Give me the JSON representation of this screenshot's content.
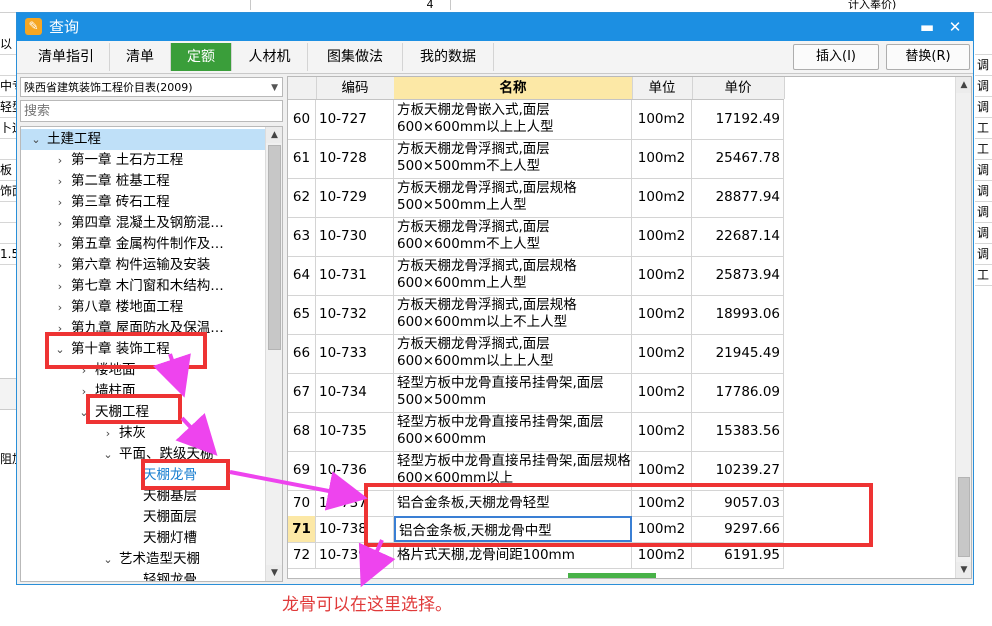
{
  "background": {
    "top_cells": [
      "",
      "4"
    ],
    "top_right_text": "计入奉价)",
    "left_fragments": [
      "以",
      "",
      "中专",
      "轻型",
      "卜运",
      "",
      "板",
      "饰面",
      "",
      "",
      "1.5"
    ],
    "right_fragments": [
      "",
      "调",
      "调",
      "调",
      "工",
      "工",
      "调",
      "调",
      "调",
      "调",
      "调",
      "工"
    ],
    "left_lower_fragment": "阻加"
  },
  "dialog": {
    "title": "查询",
    "title_icon": "query-icon",
    "minimize_symbol": "▬",
    "close_symbol": "✕",
    "tabs": [
      {
        "label": "清单指引",
        "active": false
      },
      {
        "label": "清单",
        "active": false
      },
      {
        "label": "定额",
        "active": true
      },
      {
        "label": "人材机",
        "active": false
      },
      {
        "label": "图集做法",
        "active": false
      },
      {
        "label": "我的数据",
        "active": false
      }
    ],
    "insert_button": "插入(I)",
    "replace_button": "替换(R)",
    "accent_color": "#3a9e3a",
    "title_color": "#1c8fe2"
  },
  "left_panel": {
    "library": "陕西省建筑装饰工程价目表(2009)",
    "search_placeholder": "搜索",
    "tree": [
      {
        "label": "土建工程",
        "level": 0,
        "expanded": true,
        "selected": true
      },
      {
        "label": "第一章  土石方工程",
        "level": 1,
        "expanded": false
      },
      {
        "label": "第二章  桩基工程",
        "level": 1,
        "expanded": false
      },
      {
        "label": "第三章  砖石工程",
        "level": 1,
        "expanded": false
      },
      {
        "label": "第四章  混凝土及钢筋混…",
        "level": 1,
        "expanded": false
      },
      {
        "label": "第五章  金属构件制作及…",
        "level": 1,
        "expanded": false
      },
      {
        "label": "第六章  构件运输及安装",
        "level": 1,
        "expanded": false
      },
      {
        "label": "第七章  木门窗和木结构…",
        "level": 1,
        "expanded": false
      },
      {
        "label": "第八章  楼地面工程",
        "level": 1,
        "expanded": false
      },
      {
        "label": "第九章  屋面防水及保温…",
        "level": 1,
        "expanded": false
      },
      {
        "label": "第十章  装饰工程",
        "level": 1,
        "expanded": true
      },
      {
        "label": "楼地面",
        "level": 2,
        "expanded": false
      },
      {
        "label": "墙柱面",
        "level": 2,
        "expanded": false
      },
      {
        "label": "天棚工程",
        "level": 2,
        "expanded": true
      },
      {
        "label": "抹灰",
        "level": 3,
        "expanded": false
      },
      {
        "label": "平面、跌级天棚",
        "level": 3,
        "expanded": true
      },
      {
        "label": "天棚龙骨",
        "level": 4,
        "leaf": true,
        "link": true
      },
      {
        "label": "天棚基层",
        "level": 4,
        "leaf": true
      },
      {
        "label": "天棚面层",
        "level": 4,
        "leaf": true
      },
      {
        "label": "天棚灯槽",
        "level": 4,
        "leaf": true
      },
      {
        "label": "艺术造型天棚",
        "level": 3,
        "expanded": true
      },
      {
        "label": "轻钢龙骨",
        "level": 4,
        "leaf": true
      }
    ]
  },
  "grid": {
    "headers": [
      "",
      "编码",
      "名称",
      "单位",
      "单价"
    ],
    "rows": [
      {
        "no": "60",
        "code": "10-727",
        "name": "方板天棚龙骨嵌入式,面层600×600mm以上上人型",
        "unit": "100m2",
        "price": "17192.49"
      },
      {
        "no": "61",
        "code": "10-728",
        "name": "方板天棚龙骨浮搁式,面层500×500mm不上人型",
        "unit": "100m2",
        "price": "25467.78"
      },
      {
        "no": "62",
        "code": "10-729",
        "name": "方板天棚龙骨浮搁式,面层规格500×500mm上人型",
        "unit": "100m2",
        "price": "28877.94"
      },
      {
        "no": "63",
        "code": "10-730",
        "name": "方板天棚龙骨浮搁式,面层600×600mm不上人型",
        "unit": "100m2",
        "price": "22687.14"
      },
      {
        "no": "64",
        "code": "10-731",
        "name": "方板天棚龙骨浮搁式,面层规格600×600mm上人型",
        "unit": "100m2",
        "price": "25873.94"
      },
      {
        "no": "65",
        "code": "10-732",
        "name": "方板天棚龙骨浮搁式,面层规格600×600mm以上不上人型",
        "unit": "100m2",
        "price": "18993.06"
      },
      {
        "no": "66",
        "code": "10-733",
        "name": "方板天棚龙骨浮搁式,面层600×600mm以上上人型",
        "unit": "100m2",
        "price": "21945.49"
      },
      {
        "no": "67",
        "code": "10-734",
        "name": "轻型方板中龙骨直接吊挂骨架,面层500×500mm",
        "unit": "100m2",
        "price": "17786.09"
      },
      {
        "no": "68",
        "code": "10-735",
        "name": "轻型方板中龙骨直接吊挂骨架,面层600×600mm",
        "unit": "100m2",
        "price": "15383.56"
      },
      {
        "no": "69",
        "code": "10-736",
        "name": "轻型方板中龙骨直接吊挂骨架,面层规格600×600mm以上",
        "unit": "100m2",
        "price": "10239.27"
      },
      {
        "no": "70",
        "code": "10-737",
        "name": "铝合金条板,天棚龙骨轻型",
        "unit": "100m2",
        "price": "9057.03"
      },
      {
        "no": "71",
        "code": "10-738",
        "name": "铝合金条板,天棚龙骨中型",
        "unit": "100m2",
        "price": "9297.66",
        "current": true
      },
      {
        "no": "72",
        "code": "10-739",
        "name": "格片式天棚,龙骨间距100mm",
        "unit": "100m2",
        "price": "6191.95"
      }
    ]
  },
  "annotation": {
    "note": "龙骨可以在这里选择。",
    "color": "#ee3333"
  }
}
